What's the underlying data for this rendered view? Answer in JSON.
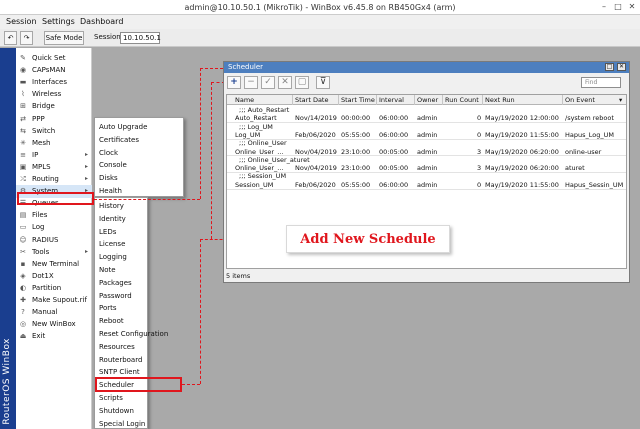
{
  "window": {
    "title": "admin@10.10.50.1 (MikroTik) - WinBox v6.45.8 on RB450Gx4 (arm)",
    "minimize": "–",
    "maximize": "□",
    "close": "✕"
  },
  "menubar": {
    "session": "Session",
    "settings": "Settings",
    "dashboard": "Dashboard"
  },
  "toolbar": {
    "undo": "↶",
    "redo": "↷",
    "safe_mode": "Safe Mode",
    "session_label": "Session:",
    "session_value": "10.10.50.1"
  },
  "brand": {
    "vertical_text": "RouterOS WinBox",
    "color": "#1a3e8f"
  },
  "main_menu": [
    {
      "label": "Quick Set",
      "icon": "quickset-icon",
      "glyph": "✎",
      "arrow": ""
    },
    {
      "label": "CAPsMAN",
      "icon": "capsman-icon",
      "glyph": "◉",
      "arrow": ""
    },
    {
      "label": "Interfaces",
      "icon": "interfaces-icon",
      "glyph": "▬",
      "arrow": ""
    },
    {
      "label": "Wireless",
      "icon": "wireless-icon",
      "glyph": "⌇",
      "arrow": ""
    },
    {
      "label": "Bridge",
      "icon": "bridge-icon",
      "glyph": "⊞",
      "arrow": ""
    },
    {
      "label": "PPP",
      "icon": "ppp-icon",
      "glyph": "⇄",
      "arrow": ""
    },
    {
      "label": "Switch",
      "icon": "switch-icon",
      "glyph": "⇆",
      "arrow": ""
    },
    {
      "label": "Mesh",
      "icon": "mesh-icon",
      "glyph": "✳",
      "arrow": ""
    },
    {
      "label": "IP",
      "icon": "ip-icon",
      "glyph": "≡",
      "arrow": "▸"
    },
    {
      "label": "MPLS",
      "icon": "mpls-icon",
      "glyph": "▣",
      "arrow": "▸"
    },
    {
      "label": "Routing",
      "icon": "routing-icon",
      "glyph": "⤮",
      "arrow": "▸"
    },
    {
      "label": "System",
      "icon": "system-icon",
      "glyph": "⚙",
      "arrow": "▸"
    },
    {
      "label": "Queues",
      "icon": "queues-icon",
      "glyph": "☰",
      "arrow": ""
    },
    {
      "label": "Files",
      "icon": "files-icon",
      "glyph": "▤",
      "arrow": ""
    },
    {
      "label": "Log",
      "icon": "log-icon",
      "glyph": "▭",
      "arrow": ""
    },
    {
      "label": "RADIUS",
      "icon": "radius-icon",
      "glyph": "☺",
      "arrow": ""
    },
    {
      "label": "Tools",
      "icon": "tools-icon",
      "glyph": "✂",
      "arrow": "▸"
    },
    {
      "label": "New Terminal",
      "icon": "terminal-icon",
      "glyph": "▪",
      "arrow": ""
    },
    {
      "label": "Dot1X",
      "icon": "dot1x-icon",
      "glyph": "◈",
      "arrow": ""
    },
    {
      "label": "Partition",
      "icon": "partition-icon",
      "glyph": "◐",
      "arrow": ""
    },
    {
      "label": "Make Supout.rif",
      "icon": "supout-icon",
      "glyph": "✚",
      "arrow": ""
    },
    {
      "label": "Manual",
      "icon": "manual-icon",
      "glyph": "?",
      "arrow": ""
    },
    {
      "label": "New WinBox",
      "icon": "winbox-icon",
      "glyph": "◎",
      "arrow": ""
    },
    {
      "label": "Exit",
      "icon": "exit-icon",
      "glyph": "⏏",
      "arrow": ""
    }
  ],
  "submenu1": [
    "Auto Upgrade",
    "Certificates",
    "Clock",
    "Console",
    "Disks",
    "Health"
  ],
  "submenu2": [
    "History",
    "Identity",
    "LEDs",
    "License",
    "Logging",
    "Note",
    "Packages",
    "Password",
    "Ports",
    "Reboot",
    "Reset Configuration",
    "Resources",
    "Routerboard",
    "SNTP Client",
    "Scheduler",
    "Scripts",
    "Shutdown",
    "Special Login"
  ],
  "scheduler": {
    "title": "Scheduler",
    "find_placeholder": "Find",
    "add": "+",
    "filter": "⊽",
    "columns": [
      "Name",
      "Start Date",
      "Start Time",
      "Interval",
      "Owner",
      "Run Count",
      "Next Run",
      "On Event"
    ],
    "rows": [
      {
        "comment": ";;; Auto_Restart",
        "name": "",
        "date": "",
        "time": "",
        "interval": "",
        "owner": "",
        "count": "",
        "next": "",
        "event": ""
      },
      {
        "comment": "",
        "name": "Auto_Restart",
        "date": "Nov/14/2019",
        "time": "00:00:00",
        "interval": "06:00:00",
        "owner": "admin",
        "count": "0",
        "next": "May/19/2020 12:00:00",
        "event": "/system reboot"
      },
      {
        "comment": ";;; Log_UM",
        "name": "",
        "date": "",
        "time": "",
        "interval": "",
        "owner": "",
        "count": "",
        "next": "",
        "event": ""
      },
      {
        "comment": "",
        "name": "Log_UM",
        "date": "Feb/06/2020",
        "time": "05:55:00",
        "interval": "06:00:00",
        "owner": "admin",
        "count": "0",
        "next": "May/19/2020 11:55:00",
        "event": "Hapus_Log_UM"
      },
      {
        "comment": ";;; Online_User",
        "name": "",
        "date": "",
        "time": "",
        "interval": "",
        "owner": "",
        "count": "",
        "next": "",
        "event": ""
      },
      {
        "comment": "",
        "name": "Online_User_...",
        "date": "Nov/04/2019",
        "time": "23:10:00",
        "interval": "00:05:00",
        "owner": "admin",
        "count": "3",
        "next": "May/19/2020 06:20:00",
        "event": "online-user"
      },
      {
        "comment": ";;; Online_User_aturet",
        "name": "",
        "date": "",
        "time": "",
        "interval": "",
        "owner": "",
        "count": "",
        "next": "",
        "event": ""
      },
      {
        "comment": "",
        "name": "Online_User_...",
        "date": "Nov/04/2019",
        "time": "23:10:00",
        "interval": "00:05:00",
        "owner": "admin",
        "count": "3",
        "next": "May/19/2020 06:20:00",
        "event": "aturet"
      },
      {
        "comment": ";;; Session_UM",
        "name": "",
        "date": "",
        "time": "",
        "interval": "",
        "owner": "",
        "count": "",
        "next": "",
        "event": ""
      },
      {
        "comment": "",
        "name": "Session_UM",
        "date": "Feb/06/2020",
        "time": "05:55:00",
        "interval": "06:00:00",
        "owner": "admin",
        "count": "0",
        "next": "May/19/2020 11:55:00",
        "event": "Hapus_Sessin_UM"
      }
    ],
    "status": "5 items"
  },
  "callout": {
    "text": "Add New Schedule",
    "color": "#e0161d"
  }
}
